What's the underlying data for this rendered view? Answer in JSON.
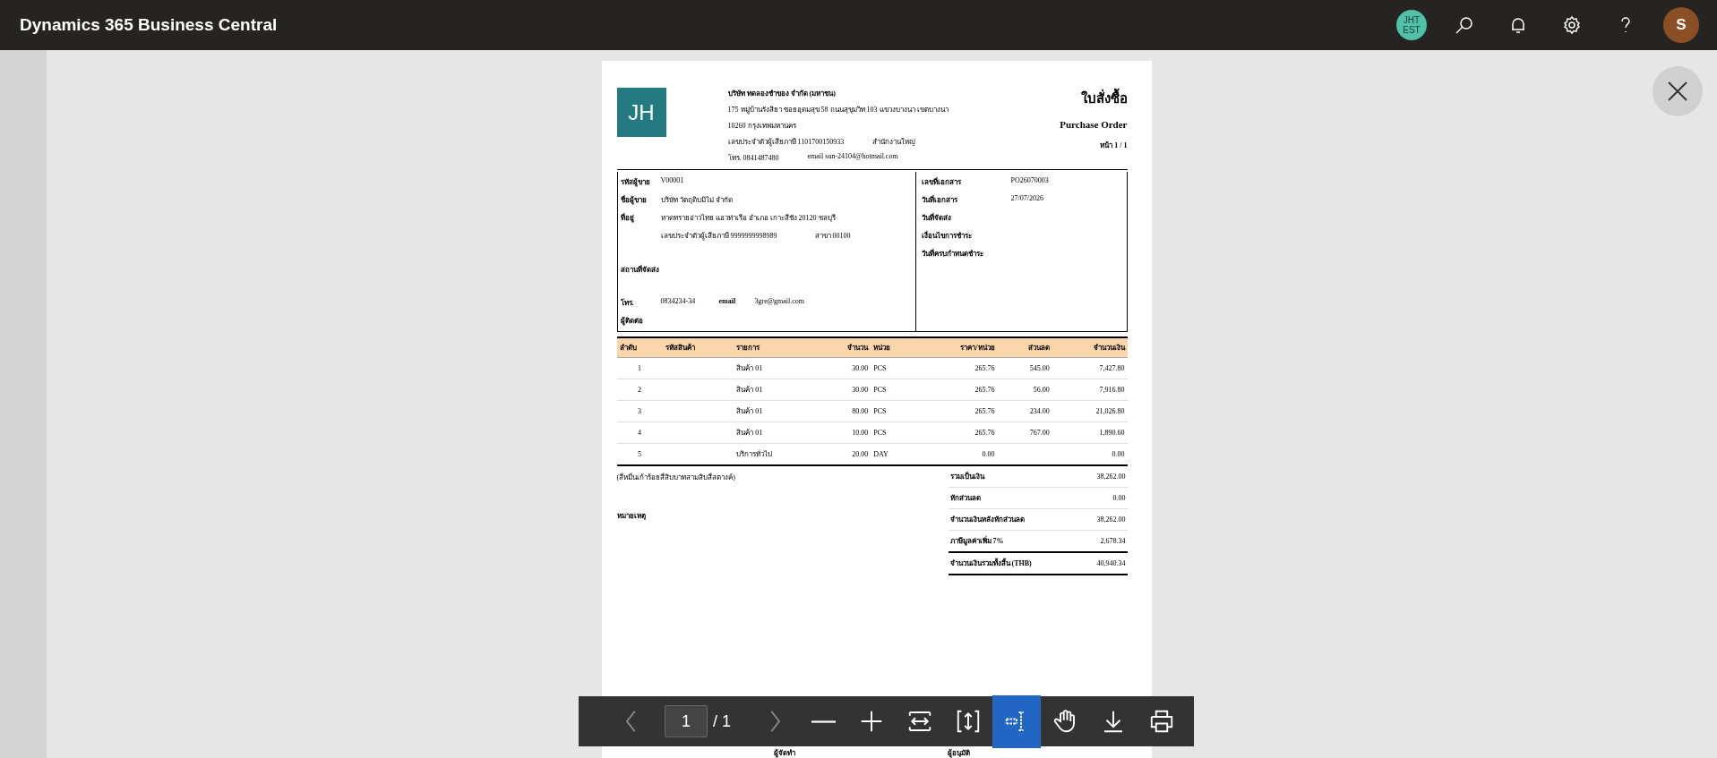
{
  "app": {
    "title": "Dynamics 365 Business Central",
    "company_badge": [
      "JHT",
      "EST"
    ],
    "avatar": "S"
  },
  "document": {
    "logo": "JH",
    "company": {
      "name": "บริษัท ทดลองชำของ จำกัด (มหาชน)",
      "address": [
        "175 หมู่บ้านรังสิยา ซอยอุดมสุข 58 ถนนสุขุมวิท 103 แขวงบางนา เขตบางนา",
        "10260 กรุงเทพมหานคร"
      ],
      "tax_id": "เลขประจำตัวผู้เสียภาษี 1101700150933",
      "branch": "สำนักงานใหญ่",
      "phone": "โทร. 0841487480",
      "email": "email sun-24104@hotmail.com"
    },
    "title_th": "ใบสั่งซื้อ",
    "title_en": "Purchase Order",
    "page": "หน้า 1 / 1",
    "vendor": [
      {
        "label": "รหัสผู้ขาย",
        "value": "V00001"
      },
      {
        "label": "ชื่อผู้ขาย",
        "value": "บริษัท วัตถุดิบมิไม่ จำกัด"
      },
      {
        "label": "ที่อยู่",
        "value": "หาดทรายอ่าวไทย แอวท่าเรือ อำเภอ เกาะสีชัง 20120 ชลบุรี"
      }
    ],
    "vendor_tax": {
      "tax_id": "เลขประจำตัวผู้เสียภาษี  9999999998989",
      "branch": "สาขา 00100"
    },
    "ship_to_label": "สถานที่จัดส่ง",
    "contact": {
      "phone_label": "โทร.",
      "phone": "0834234-34",
      "email_label": "email",
      "email": "3gre@gmail.com",
      "contact_label": "ผู้ติดต่อ"
    },
    "doc_info": [
      {
        "label": "เลขที่เอกสาร",
        "value": "PO26070003"
      },
      {
        "label": "วันที่เอกสาร",
        "value": "27/07/2026"
      },
      {
        "label": "วันที่จัดส่ง"
      },
      {
        "label": "เงื่อนไขการชำระ"
      },
      {
        "label": "วันที่ครบกำหนดชำระ"
      }
    ],
    "columns": [
      "ลำดับ",
      "รหัสสินค้า",
      "รายการ",
      "จำนวน",
      "หน่วย",
      "ราคา/หน่วย",
      "ส่วนลด",
      "จำนวนเงิน"
    ],
    "rows": [
      {
        "no": "1",
        "description": "สินค้า 01",
        "qty": "30.00",
        "unit": "PCS",
        "price": "265.76",
        "discount": "545.00",
        "amount": "7,427.80"
      },
      {
        "no": "2",
        "description": "สินค้า 01",
        "qty": "30.00",
        "unit": "PCS",
        "price": "265.76",
        "discount": "56.00",
        "amount": "7,916.80"
      },
      {
        "no": "3",
        "description": "สินค้า 01",
        "qty": "80.00",
        "unit": "PCS",
        "price": "265.76",
        "discount": "234.00",
        "amount": "21,026.80"
      },
      {
        "no": "4",
        "description": "สินค้า 01",
        "qty": "10.00",
        "unit": "PCS",
        "price": "265.76",
        "discount": "767.00",
        "amount": "1,890.60"
      },
      {
        "no": "5",
        "description": "บริการทั่วไป",
        "qty": "20.00",
        "unit": "DAY",
        "price": "0.00",
        "amount": "0.00"
      }
    ],
    "amount_words": "(สี่หมื่นเก้าร้อยสี่สิบบาทสามสิบสี่สตางค์)",
    "notes_label": "หมายเหตุ",
    "totals": [
      {
        "label": "รวมเป็นเงิน",
        "value": "38,262.00",
        "grand": false
      },
      {
        "label": "หักส่วนลด",
        "value": "0.00",
        "grand": false
      },
      {
        "label": "จำนวนเงินหลังหักส่วนลด",
        "value": "38,262.00",
        "grand": false
      },
      {
        "label": "ภาษีมูลค่าเพิ่ม 7%",
        "value": "2,678.34",
        "grand": false
      },
      {
        "label": "จำนวนเงินรวมทั้งสิ้น (THB)",
        "value": "40,940.34",
        "grand": true
      }
    ],
    "signatures": [
      "ผู้จัดทำ",
      "ผู้อนุมัติ"
    ]
  },
  "viewer_toolbar": {
    "page_value": "1",
    "page_total": "/ 1",
    "tools": [
      {
        "kind": "prev",
        "disabled": true,
        "selected": false
      },
      {
        "kind": "page"
      },
      {
        "kind": "next",
        "disabled": true,
        "selected": false
      },
      {
        "kind": "zoom-out",
        "disabled": false,
        "selected": false
      },
      {
        "kind": "zoom-in",
        "disabled": false,
        "selected": false
      },
      {
        "kind": "fit-width",
        "disabled": false,
        "selected": false
      },
      {
        "kind": "fit-page",
        "disabled": false,
        "selected": false
      },
      {
        "kind": "text-select",
        "disabled": false,
        "selected": true
      },
      {
        "kind": "pan",
        "disabled": false,
        "selected": false
      },
      {
        "kind": "download",
        "disabled": false,
        "selected": false
      },
      {
        "kind": "print",
        "disabled": false,
        "selected": false
      }
    ]
  }
}
